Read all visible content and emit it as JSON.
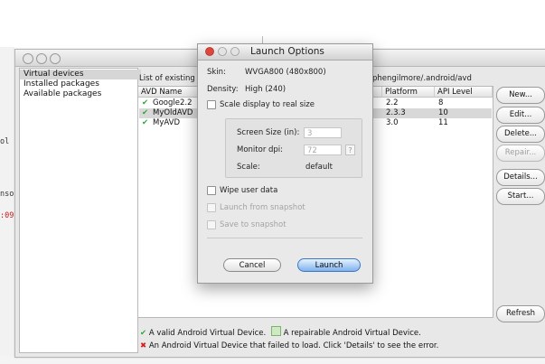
{
  "background": {
    "left_fragments": [
      "ol",
      "nso",
      ":09"
    ]
  },
  "sidebar": {
    "items": [
      {
        "label": "Virtual devices",
        "selected": true
      },
      {
        "label": "Installed packages",
        "selected": false
      },
      {
        "label": "Available packages",
        "selected": false
      }
    ]
  },
  "main": {
    "list_label": "List of existing ",
    "path_label": "phengilmore/.android/avd",
    "columns": [
      "AVD Name",
      "Platform",
      "API Level"
    ],
    "rows": [
      {
        "name": "Google2.2",
        "platform": "2.2",
        "api": "8",
        "selected": false
      },
      {
        "name": "MyOldAVD",
        "platform": "2.3.3",
        "api": "10",
        "selected": true
      },
      {
        "name": "MyAVD",
        "platform": "3.0",
        "api": "11",
        "selected": false
      }
    ]
  },
  "buttons": {
    "new": "New...",
    "edit": "Edit...",
    "delete": "Delete...",
    "repair": "Repair...",
    "details": "Details...",
    "start": "Start...",
    "refresh": "Refresh"
  },
  "legend": {
    "valid": "A valid Android Virtual Device.",
    "repairable": "A repairable Android Virtual Device.",
    "failed": "An Android Virtual Device that failed to load. Click 'Details' to see the error."
  },
  "dialog": {
    "title": "Launch Options",
    "skin_label": "Skin:",
    "skin_value": "WVGA800 (480x800)",
    "density_label": "Density:",
    "density_value": "High (240)",
    "scale_label": "Scale display to real size",
    "screen_size_label": "Screen Size (in):",
    "screen_size_value": "3",
    "monitor_dpi_label": "Monitor dpi:",
    "monitor_dpi_value": "72",
    "help_label": "?",
    "scale_value_label": "Scale:",
    "scale_value": "default",
    "wipe_label": "Wipe user data",
    "launch_snapshot_label": "Launch from snapshot",
    "save_snapshot_label": "Save to snapshot",
    "cancel": "Cancel",
    "launch": "Launch"
  },
  "colors": {
    "check": "#2ea83a",
    "error": "#d21f1f",
    "launch_button": "#7fb2ee"
  }
}
